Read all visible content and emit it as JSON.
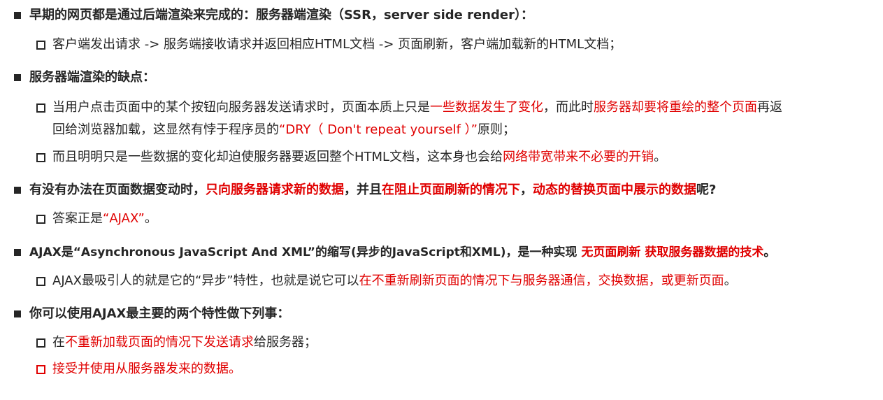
{
  "bullets": {
    "b1": {
      "text": "早期的网页都是通过后端渲染来完成的：服务器端渲染（SSR，server side render）："
    },
    "b1_1": {
      "text": "客户端发出请求 -> 服务端接收请求并返回相应HTML文档 -> 页面刷新，客户端加载新的HTML文档；"
    },
    "b2": {
      "text": "服务器端渲染的缺点："
    },
    "b2_1": {
      "seg1": "当用户点击页面中的某个按钮向服务器发送请求时，页面本质上只是",
      "seg2": "一些数据发生了变化",
      "seg3": "，而此时",
      "seg4": "服务器却要将重绘的整个页面",
      "seg5": "再返",
      "seg6": "回给浏览器加载，这显然有悖于程序员的",
      "seg7": "“DRY（ Don't repeat yourself ）”",
      "seg8": "原则；"
    },
    "b2_2": {
      "seg1": "而且明明只是一些数据的变化却迫使服务器要返回整个HTML文档，这本身也会给",
      "seg2": "网络带宽带来不必要的开销",
      "seg3": "。"
    },
    "b3": {
      "seg1": "有没有办法在页面数据变动时，",
      "seg2": "只向服务器请求新的数据",
      "seg3": "，并且",
      "seg4": "在阻止页面刷新的情况下",
      "seg5": "，",
      "seg6": "动态的替换页面中展示的数据",
      "seg7": "呢?"
    },
    "b3_1": {
      "seg1": "答案正是",
      "seg2": "“AJAX”",
      "seg3": "。"
    },
    "b4": {
      "seg1": "AJAX是“Asynchronous JavaScript And XML”的缩写(异步的JavaScript和XML)，是一种实现 ",
      "seg2": "无页面刷新 获取服务器数据的技术",
      "seg3": "。"
    },
    "b4_1": {
      "seg1": "AJAX最吸引人的就是它的“异步”特性，也就是说它可以",
      "seg2": "在不重新刷新页面的情况下与服务器通信，交换数据，或更新页面",
      "seg3": "。"
    },
    "b5": {
      "text": "你可以使用AJAX最主要的两个特性做下列事："
    },
    "b5_1": {
      "seg1": "在",
      "seg2": "不重新加载页面的情况下发送请求",
      "seg3": "给服务器；"
    },
    "b5_2": {
      "text": "接受并使用从服务器发来的数据。"
    }
  },
  "colors": {
    "text": "#262626",
    "highlight": "#e00000"
  }
}
